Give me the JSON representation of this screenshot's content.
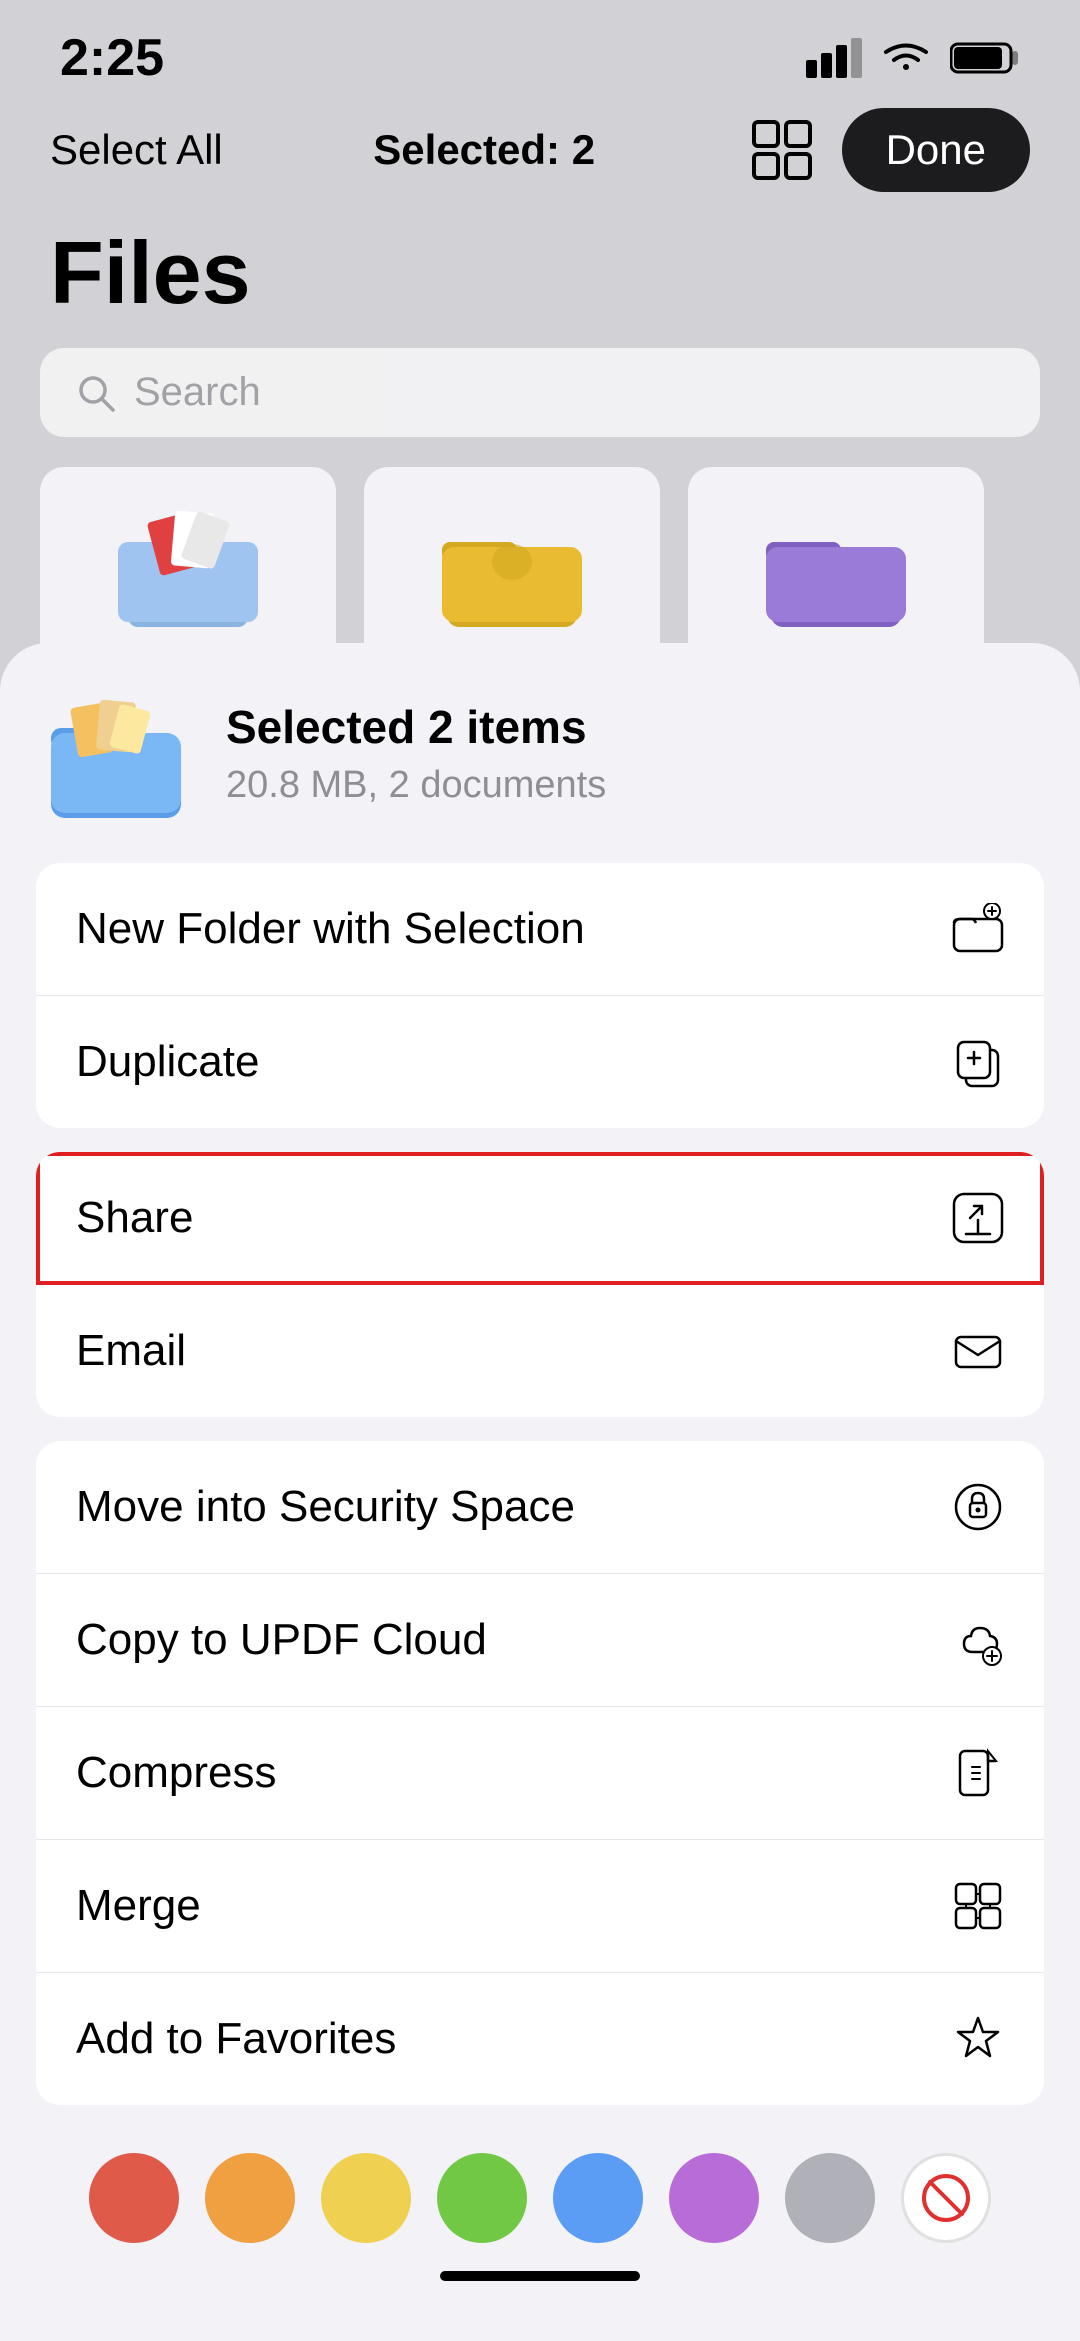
{
  "status_bar": {
    "time": "2:25"
  },
  "nav_bar": {
    "select_all_label": "Select All",
    "selected_count_label": "Selected: 2",
    "done_label": "Done"
  },
  "page": {
    "title": "Files"
  },
  "search": {
    "placeholder": "Search"
  },
  "bottom_sheet": {
    "selected_title": "Selected 2 items",
    "selected_sub": "20.8 MB, 2 documents"
  },
  "menu_groups": [
    {
      "id": "group1",
      "items": [
        {
          "id": "new-folder",
          "label": "New Folder with Selection",
          "icon": "folder-plus"
        },
        {
          "id": "duplicate",
          "label": "Duplicate",
          "icon": "copy-plus"
        }
      ]
    },
    {
      "id": "group2",
      "items": [
        {
          "id": "share",
          "label": "Share",
          "icon": "share",
          "highlighted": true
        },
        {
          "id": "email",
          "label": "Email",
          "icon": "envelope"
        }
      ]
    },
    {
      "id": "group3",
      "items": [
        {
          "id": "security-space",
          "label": "Move into Security Space",
          "icon": "lock-shield"
        },
        {
          "id": "updf-cloud",
          "label": "Copy to UPDF Cloud",
          "icon": "cloud-plus"
        },
        {
          "id": "compress",
          "label": "Compress",
          "icon": "file-zip"
        },
        {
          "id": "merge",
          "label": "Merge",
          "icon": "merge"
        },
        {
          "id": "favorites",
          "label": "Add to Favorites",
          "icon": "star"
        }
      ]
    }
  ],
  "colors": [
    {
      "id": "red",
      "class": "color-circle-red"
    },
    {
      "id": "orange",
      "class": "color-circle-orange"
    },
    {
      "id": "yellow",
      "class": "color-circle-yellow"
    },
    {
      "id": "green",
      "class": "color-circle-green"
    },
    {
      "id": "blue",
      "class": "color-circle-blue"
    },
    {
      "id": "purple",
      "class": "color-circle-purple"
    },
    {
      "id": "gray",
      "class": "color-circle-gray"
    },
    {
      "id": "none",
      "class": "color-circle-none"
    }
  ]
}
